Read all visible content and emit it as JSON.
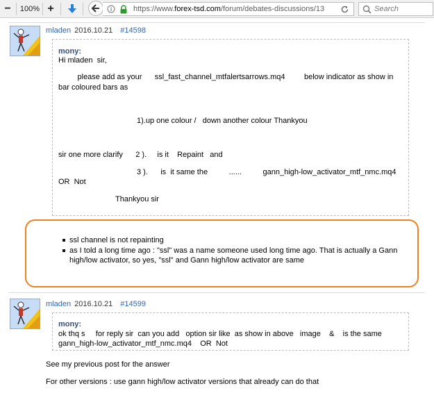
{
  "browser": {
    "zoom": "100%",
    "url_prefix": "https://www.",
    "url_domain": "forex-tsd.com",
    "url_path": "/forum/debates-discussions/13",
    "search_placeholder": "Search"
  },
  "post1": {
    "author": "mladen",
    "time": "2016.10.21",
    "number": "#14598",
    "quote_author": "mony:",
    "quote_lines": [
      "Hi mladen  sir,",
      "         please add as your      ssl_fast_channel_mtfalertsarrows.mq4         below indicator as show in",
      "bar coloured bars as",
      "1).up one colour /   down another colour Thankyou",
      "sir one more clarify      2 ).     is it    Repaint   and",
      "3 ).      is  it same the          ......          gann_high-low_activator_mtf_nmc.mq4",
      "OR  Not",
      "Thankyou sir"
    ],
    "reply_items": [
      "ssl channel is not repainting",
      "as I told a long time ago : \"ssl\" was a name someone used long time ago. That is actually a Gann high/low activator, so yes, \"ssl\" and Gann high/low activator are same"
    ]
  },
  "post2": {
    "author": "mladen",
    "time": "2016.10.21",
    "number": "#14599",
    "quote_author": "mony:",
    "quote_lines": [
      "ok thq s     for reply sir  can you add   option sir like  as show in above   image    &    is the same",
      "gann_high-low_activator_mtf_nmc.mq4    OR  Not"
    ],
    "reply_lines": [
      "See my previous post for the answer",
      "For other versions : use gann high/low activator versions that already can do that"
    ]
  },
  "colors": {
    "link": "#3366aa",
    "highlight": "#f07f1f"
  }
}
